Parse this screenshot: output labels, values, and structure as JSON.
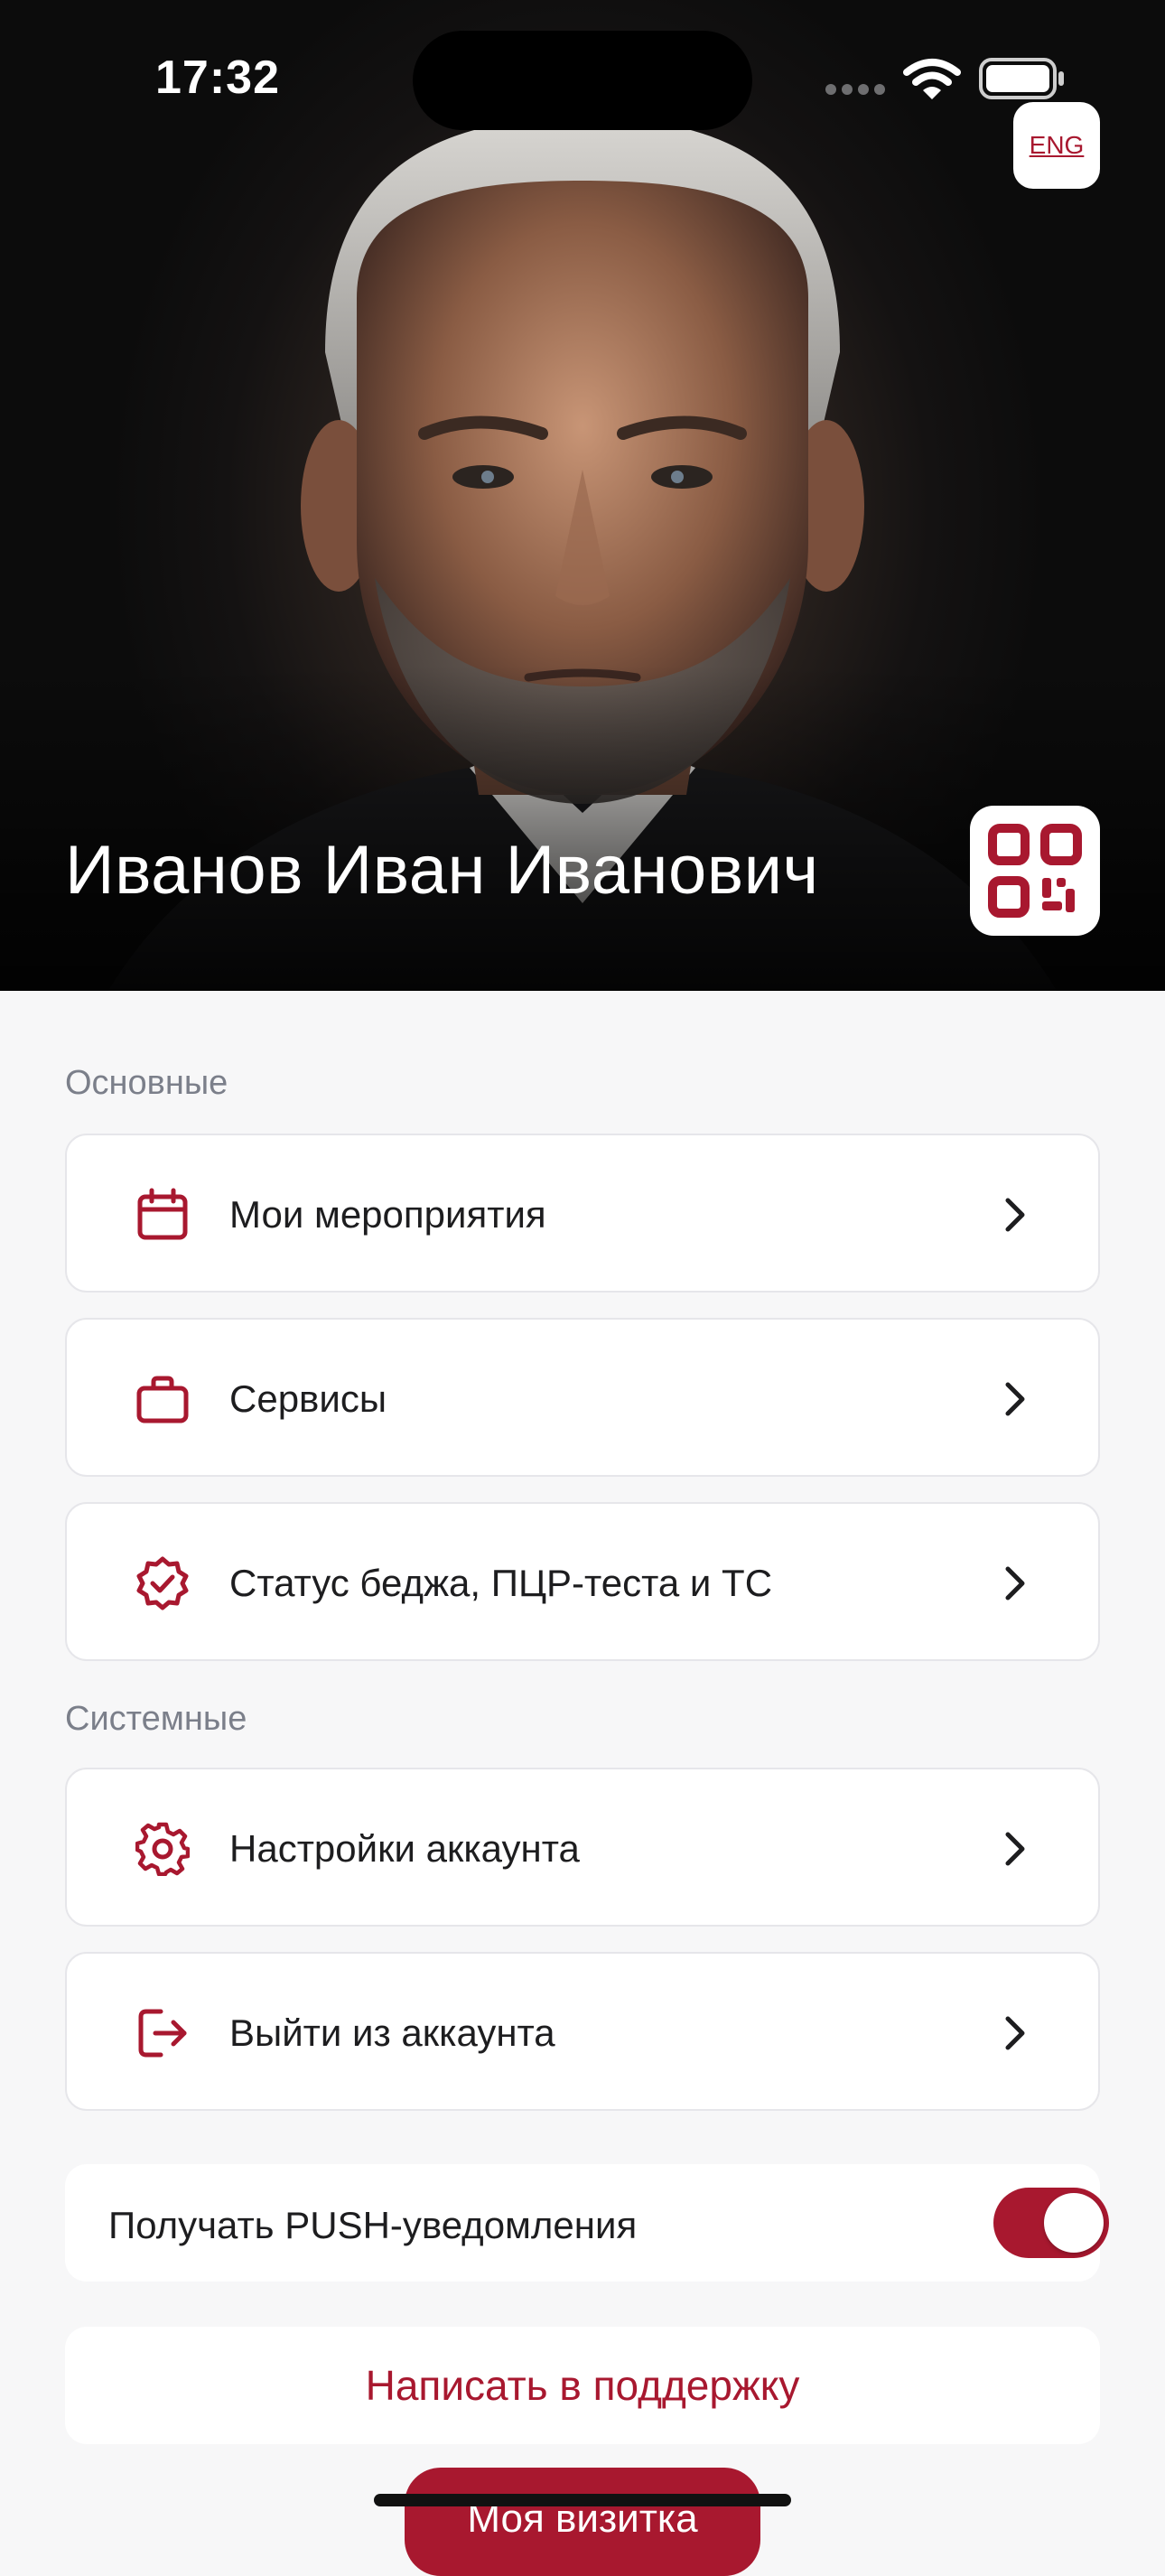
{
  "status_bar": {
    "time": "17:32"
  },
  "header": {
    "language_button": "ENG",
    "user_name": "Иванов Иван Иванович"
  },
  "sections": {
    "main": {
      "title": "Основные",
      "items": [
        {
          "label": "Мои мероприятия",
          "icon": "calendar-icon"
        },
        {
          "label": "Сервисы",
          "icon": "briefcase-icon"
        },
        {
          "label": "Статус беджа, ПЦР-теста и ТС",
          "icon": "badge-check-icon"
        }
      ]
    },
    "system": {
      "title": "Системные",
      "items": [
        {
          "label": "Настройки аккаунта",
          "icon": "gear-icon"
        },
        {
          "label": "Выйти из аккаунта",
          "icon": "logout-icon"
        }
      ]
    }
  },
  "push": {
    "label": "Получать PUSH-уведомления",
    "enabled": true
  },
  "support_button": "Написать в поддержку",
  "business_card_button": "Моя визитка",
  "colors": {
    "accent": "#a8182f",
    "background": "#f7f7f8"
  }
}
